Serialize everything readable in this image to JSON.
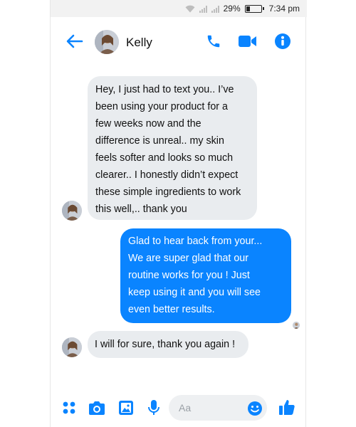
{
  "status": {
    "battery": "29%",
    "battery_level": 0.29,
    "time": "7:34 pm"
  },
  "header": {
    "name": "Kelly"
  },
  "messages": [
    {
      "from": "them",
      "lines": [
        "Hey, I just had to text you.. I’ve",
        "been using your product for a",
        "few weeks now and the",
        "difference is unreal.. my skin",
        "feels softer and looks so much",
        "clearer.. I honestly didn’t expect",
        "these simple ingredients to work",
        "this well,.. thank you"
      ]
    },
    {
      "from": "me",
      "lines": [
        "Glad to hear back from your...",
        "We are super glad that our",
        "routine works for you ! Just",
        "keep using it and you will see",
        "even better results."
      ]
    },
    {
      "from": "them",
      "lines": [
        "I will for sure, thank you again !"
      ]
    }
  ],
  "composer": {
    "placeholder": "Aa"
  },
  "colors": {
    "accent": "#0a84ff",
    "incoming_bg": "#e9ecef"
  },
  "icons": [
    "back-arrow-icon",
    "phone-icon",
    "video-icon",
    "info-icon",
    "apps-icon",
    "camera-icon",
    "image-icon",
    "mic-icon",
    "emoji-icon",
    "thumbs-up-icon"
  ]
}
